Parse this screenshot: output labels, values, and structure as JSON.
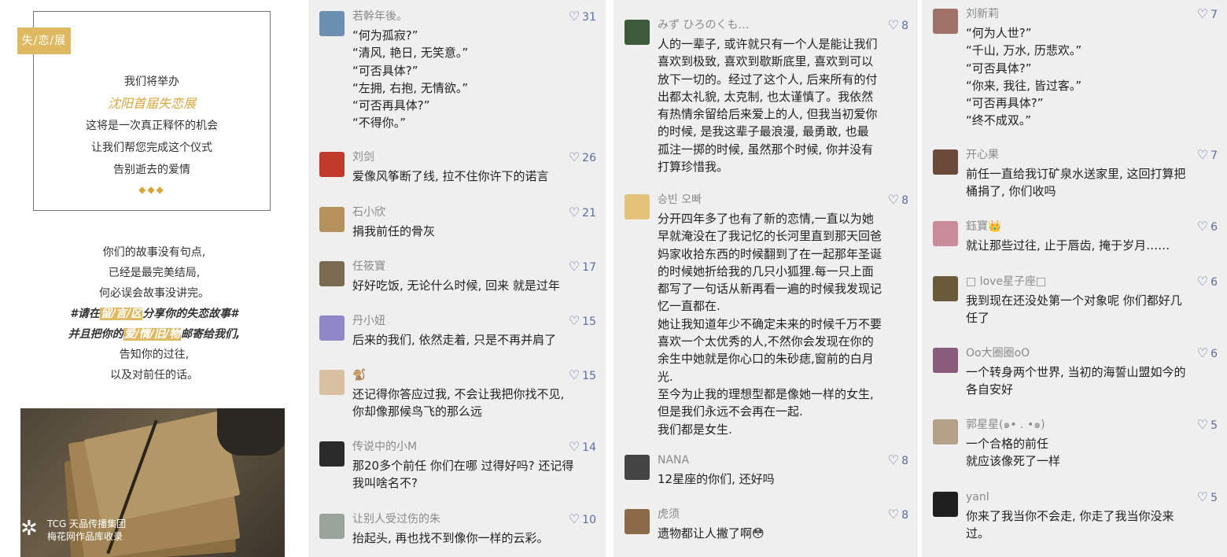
{
  "ad": {
    "tag": "失/恋/展",
    "line1": "我们将举办",
    "headline": "沈阳首届失恋展",
    "line3": "这将是一次真正释怀的机会",
    "line4": "让我们帮您完成这个仪式",
    "line5": "告别逝去的爱情",
    "diamonds": "◆◆◆"
  },
  "story": {
    "l1": "你们的故事没有句点,",
    "l2": "已经是最完美结局,",
    "l3": "何必误会故事没讲完。",
    "l4a": "#请在",
    "l4hl": "留/言/区",
    "l4b": "分享你的失恋故事#",
    "l5a": "并且把你的",
    "l5hl": "爱/情/旧/物",
    "l5b": "邮寄给我们,",
    "l6": "告知你的过往,",
    "l7": "以及对前任的话。"
  },
  "photo": {
    "brand_line1": "TCG 天品传播集团",
    "brand_line2": "梅花网作品库收录"
  },
  "columns": [
    [
      {
        "name": "若幹年後。",
        "likes": "31",
        "color": "#6a8fb0",
        "text": [
          "“何为孤寂?”",
          "“清风, 艳日, 无笑意。”",
          "“可否具体?”",
          "“左拥, 右抱, 无情欲。”",
          "“可否再具体?”",
          "“不得你。”"
        ]
      },
      {
        "name": "刘剑",
        "likes": "26",
        "color": "#c0392b",
        "text": [
          "爱像风筝断了线, 拉不住你许下的诺言"
        ]
      },
      {
        "name": "石小欣",
        "likes": "21",
        "color": "#b5925b",
        "text": [
          "捐我前任的骨灰"
        ]
      },
      {
        "name": "任筱寶",
        "likes": "17",
        "color": "#7a6a50",
        "text": [
          "好好吃饭, 无论什么时候, 回来 就是过年"
        ]
      },
      {
        "name": "丹小妞",
        "likes": "15",
        "color": "#8e87c9",
        "text": [
          "后来的我们, 依然走着, 只是不再并肩了"
        ]
      },
      {
        "name": "🐒",
        "likes": "15",
        "color": "#d9c0a2",
        "text": [
          "还记得你答应过我, 不会让我把你找不见,",
          "你却像那候鸟飞的那么远"
        ]
      },
      {
        "name": "传说中的小M",
        "likes": "14",
        "color": "#2b2b2b",
        "text": [
          "那20多个前任 你们在哪 过得好吗? 还记得",
          "我叫啥名不?"
        ]
      },
      {
        "name": "让别人受过伤的朱",
        "likes": "10",
        "color": "#9aa39a",
        "text": [
          "抬起头, 再也找不到像你一样的云彩。"
        ]
      }
    ],
    [
      {
        "name": "みず ひろのくも…",
        "likes": "8",
        "color": "#3d5a3a",
        "text": [
          "人的一辈子, 或许就只有一个人是能让我们",
          "喜欢到极致, 喜欢到歇斯底里, 喜欢到可以",
          "放下一切的。经过了这个人, 后来所有的付",
          "出都太礼貌, 太克制, 也太谨慎了。我依然",
          "有热情余留给后来爱上的人, 但我当初爱你",
          "的时候, 是我这辈子最浪漫, 最勇敢, 也最",
          "孤注一掷的时候, 虽然那个时候, 你并没有",
          "打算珍惜我。"
        ]
      },
      {
        "name": "승빈 오빠",
        "likes": "8",
        "color": "#e3c27a",
        "text": [
          "分开四年多了也有了新的恋情,一直以为她",
          "早就淹没在了我记忆的长河里直到那天回爸",
          "妈家收拾东西的时候翻到了在一起那年圣诞",
          "的时候她折给我的几只小狐狸.每一只上面",
          "都写了一句话从新再看一遍的时候我发现记",
          "忆一直都在.",
          "她让我知道年少不确定未来的时候千万不要",
          "喜欢一个太优秀的人,不然你会发现在你的",
          "余生中她就是你心口的朱砂痣,窗前的白月",
          "光.",
          "至今为止我的理想型都是像她一样的女生,",
          "但是我们永远不会再在一起.",
          "我们都是女生."
        ]
      },
      {
        "name": "NANA",
        "likes": "8",
        "color": "#444444",
        "text": [
          "12星座的你们, 还好吗"
        ]
      },
      {
        "name": "虎须",
        "likes": "8",
        "color": "#8b6a4a",
        "text": [
          "遗物都让人撇了啊😳"
        ]
      }
    ],
    [
      {
        "name": "刘新莉",
        "likes": "7",
        "color": "#a0736a",
        "text": [
          "“何为人世?”",
          " “千山, 万水, 历悲欢。”",
          "“可否具体?”",
          "“你来, 我往, 皆过客。”",
          "“可否再具体?”",
          " “终不成双。”"
        ]
      },
      {
        "name": "开心果",
        "likes": "7",
        "color": "#6b4a3a",
        "text": [
          "前任一直给我订矿泉水送家里, 这回打算把",
          "桶捐了, 你们收吗"
        ]
      },
      {
        "name": "鈺寶👑",
        "likes": "6",
        "color": "#c98a9a",
        "text": [
          "就让那些过往, 止于唇齿, 掩于岁月……"
        ]
      },
      {
        "name": "□ love星子座□",
        "likes": "6",
        "color": "#6a5a3a",
        "text": [
          "我到现在还没处第一个对象呢 你们都好几",
          "任了"
        ]
      },
      {
        "name": "Oo大圈圈oO",
        "likes": "6",
        "color": "#8a5a7a",
        "text": [
          "一个转身两个世界, 当初的海誓山盟如今的",
          "各自安好"
        ]
      },
      {
        "name": "郭星星(๑• . •๑)",
        "likes": "5",
        "color": "#b5a08a",
        "text": [
          "一个合格的前任",
          "就应该像死了一样"
        ]
      },
      {
        "name": "yanl",
        "likes": "5",
        "color": "#1f1f1f",
        "text": [
          "你来了我当你不会走, 你走了我当你没来",
          "过。"
        ]
      }
    ]
  ]
}
